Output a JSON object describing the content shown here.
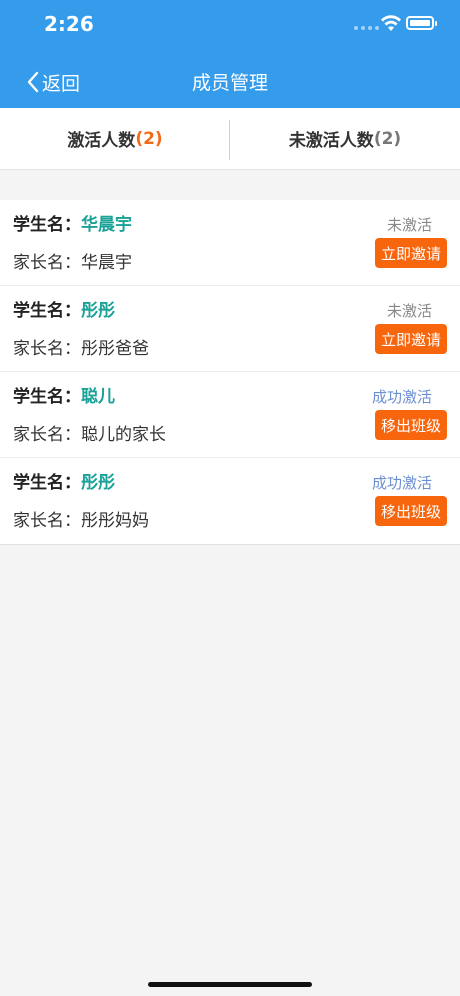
{
  "status_bar": {
    "time": "2:26"
  },
  "header": {
    "back_label": "返回",
    "title": "成员管理",
    "color": "#359cec"
  },
  "tabs": [
    {
      "label": "激活人数",
      "count": "(2)"
    },
    {
      "label": "未激活人数",
      "count": "(2)"
    }
  ],
  "members": [
    {
      "student_prefix": "学生名：",
      "student_name": "华晨宇",
      "parent_prefix": "家长名：",
      "parent_name": "华晨宇",
      "status": "未激活",
      "action": "立即邀请"
    },
    {
      "student_prefix": "学生名：",
      "student_name": "彤彤",
      "parent_prefix": "家长名：",
      "parent_name": "彤彤爸爸",
      "status": "未激活",
      "action": "立即邀请"
    },
    {
      "student_prefix": "学生名：",
      "student_name": "聪儿",
      "parent_prefix": "家长名：",
      "parent_name": "聪儿的家长",
      "status": "成功激活",
      "action": "移出班级"
    },
    {
      "student_prefix": "学生名：",
      "student_name": "彤彤",
      "parent_prefix": "家长名：",
      "parent_name": "彤彤妈妈",
      "status": "成功激活",
      "action": "移出班级"
    }
  ],
  "colors": {
    "accent": "#f7650d",
    "student_name": "#1aa198",
    "status_active": "#6b8fd0"
  }
}
